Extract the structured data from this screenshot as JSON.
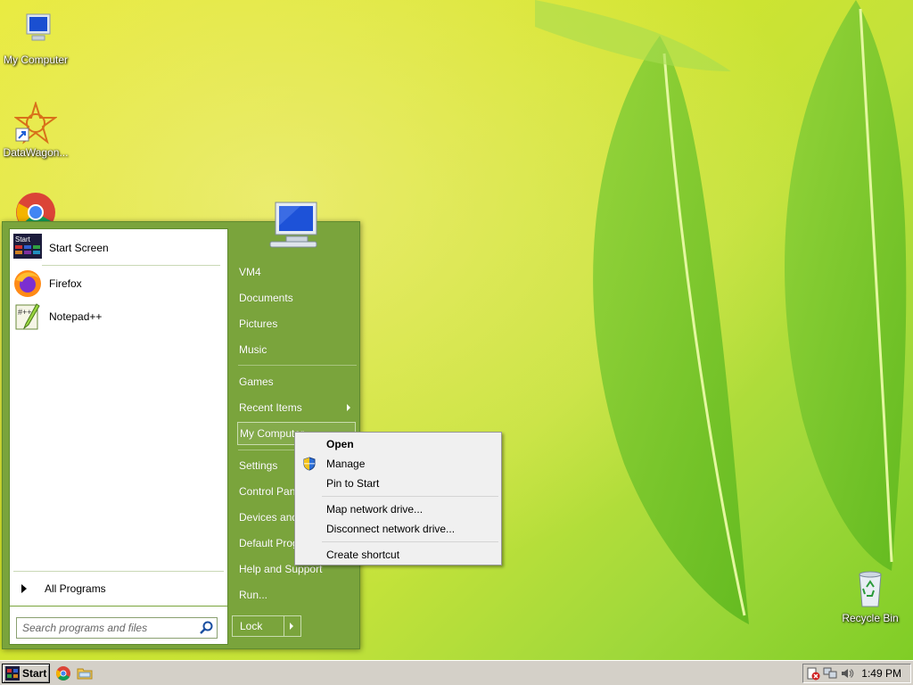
{
  "desktop": {
    "icons": [
      {
        "label": "My Computer",
        "icon": "computer-icon"
      },
      {
        "label": "DataWagon...",
        "icon": "datawagon-icon"
      },
      {
        "label": "",
        "icon": "chrome-icon"
      },
      {
        "label": "Recycle Bin",
        "icon": "recycle-bin-icon"
      }
    ]
  },
  "start_menu": {
    "pinned": [
      {
        "label": "Start Screen",
        "icon": "start-screen-icon"
      },
      {
        "label": "Firefox",
        "icon": "firefox-icon"
      },
      {
        "label": "Notepad++",
        "icon": "notepadpp-icon"
      }
    ],
    "all_programs": "All Programs",
    "search_placeholder": "Search programs and files",
    "right": {
      "user": "VM4",
      "documents": "Documents",
      "pictures": "Pictures",
      "music": "Music",
      "games": "Games",
      "recent_items": "Recent Items",
      "my_computer": "My Computer",
      "settings": "Settings",
      "control_panel": "Control Panel",
      "devices": "Devices and Printers",
      "default_programs": "Default Programs",
      "help": "Help and Support",
      "run": "Run..."
    },
    "lock_label": "Lock"
  },
  "context_menu": {
    "open": "Open",
    "manage": "Manage",
    "pin": "Pin to Start",
    "map": "Map network drive...",
    "disconnect": "Disconnect network drive...",
    "shortcut": "Create shortcut"
  },
  "taskbar": {
    "start_label": "Start",
    "clock": "1:49 PM"
  },
  "colors": {
    "start_menu_bg": "#7aa43c",
    "taskbar_bg": "#d4d0c8"
  }
}
